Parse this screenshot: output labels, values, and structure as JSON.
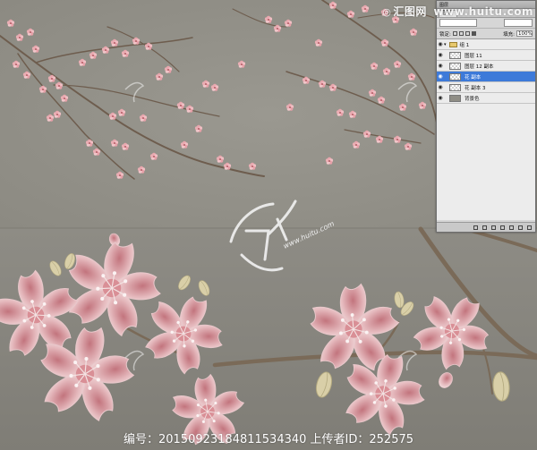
{
  "watermark": {
    "site": "汇图网",
    "domain": "www.huitu.com",
    "center_logo": "汇图网",
    "center_domain": "www.huitu.com"
  },
  "layers_panel": {
    "title": "图层",
    "tab": "图层",
    "blend_mode": "",
    "lock_label": "锁定:",
    "fill_label": "填充:",
    "fill_value": "100%",
    "layers": [
      {
        "name": "组 1",
        "type": "group",
        "selected": false
      },
      {
        "name": "图层 11",
        "type": "layer",
        "selected": false
      },
      {
        "name": "图层 12 副本",
        "type": "layer",
        "selected": false
      },
      {
        "name": "花 副本",
        "type": "layer",
        "selected": true
      },
      {
        "name": "花 副本 3",
        "type": "layer",
        "selected": false
      },
      {
        "name": "背景色",
        "type": "fill",
        "selected": false
      }
    ]
  },
  "caption": {
    "text": "编号：20150923184811534340 上传者ID：252575"
  },
  "colors": {
    "background": "#8c8b84",
    "petal": "#f1d3d5",
    "petal_dark": "#c97f86",
    "branch": "#6e5d4e",
    "selected_layer": "#3d7ad9"
  }
}
